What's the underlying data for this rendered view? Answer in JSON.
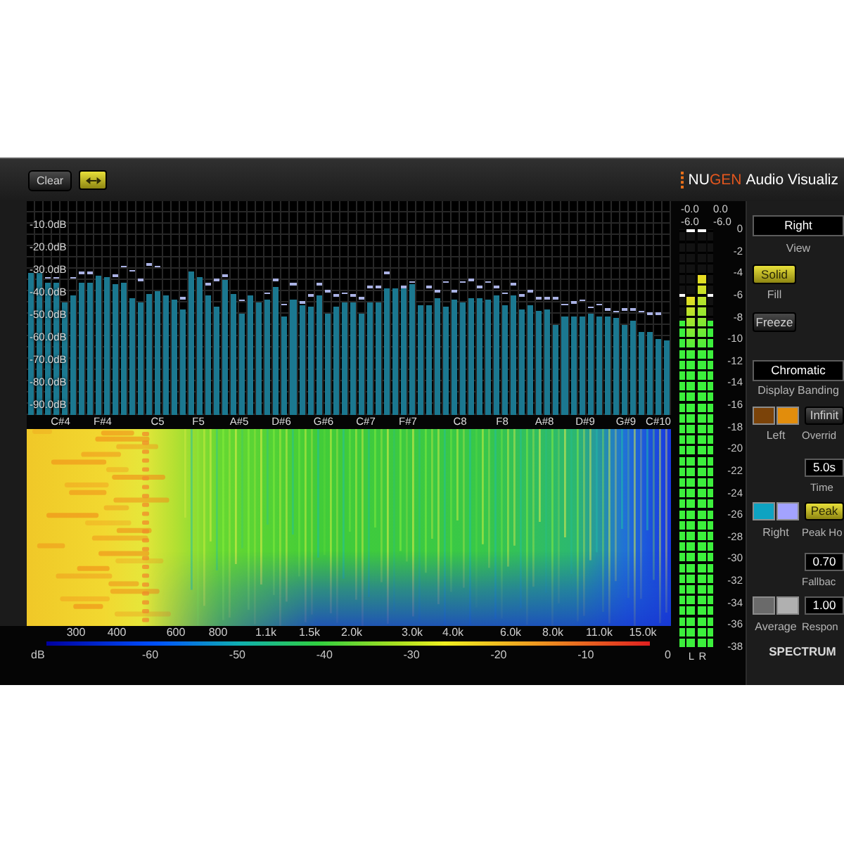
{
  "top_bar": {
    "clear_button": {
      "label": "Clear"
    },
    "toggle_button": {
      "on": true
    },
    "logo": {
      "brand_start": "NU",
      "brand_end": "GEN"
    },
    "product_name": "Audio Visualiz"
  },
  "spectrum_chart": {
    "y_axis_labels": [
      "-10.0dB",
      "-20.0dB",
      "-30.0dB",
      "-40.0dB",
      "-50.0dB",
      "-60.0dB",
      "-70.0dB",
      "-80.0dB",
      "-90.0dB"
    ],
    "bands": [
      {
        "level": 0.663
      },
      {
        "level": 0.663
      },
      {
        "level": 0.621,
        "hold": {
          "level": 0.642
        }
      },
      {
        "level": 0.621,
        "hold": {
          "level": 0.642
        }
      },
      {
        "level": 0.526
      },
      {
        "level": 0.558,
        "hold": {
          "level": 0.642
        }
      },
      {
        "level": 0.621,
        "hold": {
          "level": 0.663
        }
      },
      {
        "level": 0.621,
        "hold": {
          "level": 0.663
        }
      },
      {
        "level": 0.653
      },
      {
        "level": 0.642
      },
      {
        "level": 0.611,
        "hold": {
          "level": 0.653
        }
      },
      {
        "level": 0.621,
        "hold": {
          "level": 0.695
        }
      },
      {
        "level": 0.547,
        "hold": {
          "level": 0.674
        }
      },
      {
        "level": 0.526,
        "hold": {
          "level": 0.632
        }
      },
      {
        "level": 0.568,
        "hold": {
          "level": 0.705
        }
      },
      {
        "level": 0.579,
        "hold": {
          "level": 0.695
        }
      },
      {
        "level": 0.558
      },
      {
        "level": 0.537
      },
      {
        "level": 0.495,
        "hold": {
          "level": 0.547
        }
      },
      {
        "level": 0.674
      },
      {
        "level": 0.642
      },
      {
        "level": 0.558,
        "hold": {
          "level": 0.611
        }
      },
      {
        "level": 0.505,
        "hold": {
          "level": 0.632
        }
      },
      {
        "level": 0.632,
        "hold": {
          "level": 0.653
        }
      },
      {
        "level": 0.568
      },
      {
        "level": 0.474,
        "hold": {
          "level": 0.537
        }
      },
      {
        "level": 0.558
      },
      {
        "level": 0.526
      },
      {
        "level": 0.537,
        "hold": {
          "level": 0.568
        }
      },
      {
        "level": 0.6,
        "hold": {
          "level": 0.632
        }
      },
      {
        "level": 0.463,
        "hold": {
          "level": 0.516
        }
      },
      {
        "level": 0.537,
        "hold": {
          "level": 0.611
        }
      },
      {
        "level": 0.516,
        "hold": {
          "level": 0.526
        }
      },
      {
        "level": 0.505,
        "hold": {
          "level": 0.558
        }
      },
      {
        "level": 0.558,
        "hold": {
          "level": 0.611
        }
      },
      {
        "level": 0.474,
        "hold": {
          "level": 0.579
        }
      },
      {
        "level": 0.505,
        "hold": {
          "level": 0.558
        }
      },
      {
        "level": 0.526,
        "hold": {
          "level": 0.568
        }
      },
      {
        "level": 0.526,
        "hold": {
          "level": 0.558
        }
      },
      {
        "level": 0.474,
        "hold": {
          "level": 0.547
        }
      },
      {
        "level": 0.526,
        "hold": {
          "level": 0.6
        }
      },
      {
        "level": 0.526,
        "hold": {
          "level": 0.6
        }
      },
      {
        "level": 0.589,
        "hold": {
          "level": 0.663
        }
      },
      {
        "level": 0.589
      },
      {
        "level": 0.589,
        "hold": {
          "level": 0.6
        }
      },
      {
        "level": 0.611,
        "hold": {
          "level": 0.621
        }
      },
      {
        "level": 0.516
      },
      {
        "level": 0.516,
        "hold": {
          "level": 0.6
        }
      },
      {
        "level": 0.547,
        "hold": {
          "level": 0.579
        }
      },
      {
        "level": 0.505,
        "hold": {
          "level": 0.621
        }
      },
      {
        "level": 0.537,
        "hold": {
          "level": 0.579
        }
      },
      {
        "level": 0.526,
        "hold": {
          "level": 0.621
        }
      },
      {
        "level": 0.547,
        "hold": {
          "level": 0.632
        }
      },
      {
        "level": 0.547,
        "hold": {
          "level": 0.6
        }
      },
      {
        "level": 0.537,
        "hold": {
          "level": 0.621
        }
      },
      {
        "level": 0.558,
        "hold": {
          "level": 0.6
        }
      },
      {
        "level": 0.516,
        "hold": {
          "level": 0.568
        }
      },
      {
        "level": 0.558,
        "hold": {
          "level": 0.611
        }
      },
      {
        "level": 0.495,
        "hold": {
          "level": 0.558
        }
      },
      {
        "level": 0.516,
        "hold": {
          "level": 0.579
        }
      },
      {
        "level": 0.484,
        "hold": {
          "level": 0.547
        }
      },
      {
        "level": 0.495,
        "hold": {
          "level": 0.547
        }
      },
      {
        "level": 0.421,
        "hold": {
          "level": 0.547
        }
      },
      {
        "level": 0.463,
        "hold": {
          "level": 0.516
        }
      },
      {
        "level": 0.463,
        "hold": {
          "level": 0.526
        }
      },
      {
        "level": 0.463,
        "hold": {
          "level": 0.537
        }
      },
      {
        "level": 0.474,
        "hold": {
          "level": 0.505
        }
      },
      {
        "level": 0.463,
        "hold": {
          "level": 0.516
        }
      },
      {
        "level": 0.463,
        "hold": {
          "level": 0.495
        }
      },
      {
        "level": 0.453,
        "hold": {
          "level": 0.484
        }
      },
      {
        "level": 0.421,
        "hold": {
          "level": 0.495
        }
      },
      {
        "level": 0.442,
        "hold": {
          "level": 0.495
        }
      },
      {
        "level": 0.389,
        "hold": {
          "level": 0.484
        }
      },
      {
        "level": 0.389,
        "hold": {
          "level": 0.474
        }
      },
      {
        "level": 0.358,
        "hold": {
          "level": 0.474
        }
      },
      {
        "level": 0.347
      }
    ],
    "note_labels": [
      "C#4",
      "F#4",
      "C5",
      "F5",
      "A#5",
      "D#6",
      "G#6",
      "C#7",
      "F#7",
      "C8",
      "F8",
      "A#8",
      "D#9",
      "G#9",
      "C#10"
    ]
  },
  "spectrogram": {
    "frequency_labels": [
      "300",
      "400",
      "600",
      "800",
      "1.1k",
      "1.5k",
      "2.0k",
      "3.0k",
      "4.0k",
      "6.0k",
      "8.0k",
      "11.0k",
      "15.0k"
    ],
    "color_scale": {
      "unit": "dB",
      "labels": [
        "-60",
        "-50",
        "-40",
        "-30",
        "-20",
        "-10",
        "0"
      ]
    }
  },
  "meter": {
    "channels": [
      {
        "label": "L",
        "readings": [
          "-0.0",
          "-6.0"
        ],
        "columns": [
          {
            "kind": "rms",
            "level": 0.78,
            "hold": {
              "level": 0.845
            }
          },
          {
            "kind": "peak",
            "level": 0.845,
            "hold": {
              "level": 1
            }
          }
        ]
      },
      {
        "label": "R",
        "readings": [
          "0.0",
          "-6.0"
        ],
        "columns": [
          {
            "kind": "peak",
            "level": 0.896,
            "hold": {
              "level": 1
            }
          },
          {
            "kind": "rms",
            "level": 0.78,
            "hold": {
              "level": 0.845
            }
          }
        ]
      }
    ],
    "scale": [
      "0",
      "-2",
      "-4",
      "-6",
      "-8",
      "-10",
      "-12",
      "-14",
      "-16",
      "-18",
      "-20",
      "-22",
      "-24",
      "-26",
      "-28",
      "-30",
      "-32",
      "-34",
      "-36",
      "-38"
    ]
  },
  "controls": {
    "view": {
      "value": "Right",
      "label": "View"
    },
    "fill": {
      "button": {
        "label": "Solid",
        "on": true
      },
      "label": "Fill"
    },
    "freeze_button": {
      "label": "Freeze",
      "on": false
    },
    "banding": {
      "value": "Chromatic",
      "label": "Display Banding"
    },
    "traces": [
      {
        "label": "Left",
        "swatches": [
          {
            "color": "#7b4309"
          },
          {
            "color": "#e28d0c"
          }
        ]
      },
      {
        "label": "Right",
        "swatches": [
          {
            "color": "#0ea3c2"
          },
          {
            "color": "#a3a3ff"
          }
        ]
      },
      {
        "label": "Average",
        "swatches": [
          {
            "color": "#6a6a6a"
          },
          {
            "color": "#b0b0b0"
          }
        ]
      }
    ],
    "override": {
      "button": {
        "label": "Infinit",
        "on": false
      },
      "label": "Overrid"
    },
    "time": {
      "value": "5.0s",
      "label": "Time"
    },
    "peak_hold": {
      "button": {
        "label": "Peak",
        "on": true
      },
      "label": "Peak Ho"
    },
    "fallback": {
      "value": "0.70",
      "label": "Fallbac"
    },
    "response": {
      "value": "1.00",
      "label": "Respon"
    },
    "section_title": "SPECTRUM"
  }
}
